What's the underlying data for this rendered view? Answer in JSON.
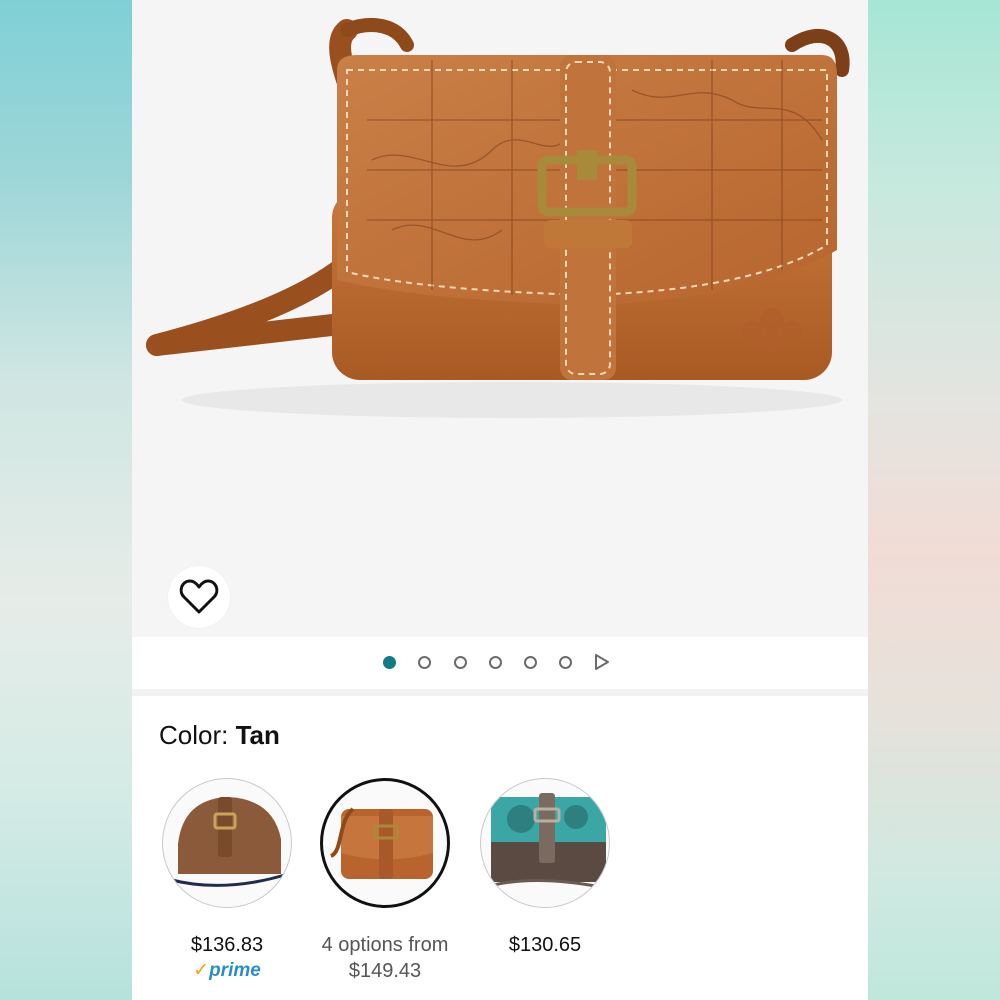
{
  "product": {
    "favorite_icon": "heart-outline-icon",
    "gallery": {
      "count": 6,
      "active_index": 0,
      "next_icon": "play-triangle-icon",
      "accent": "#0e7c86"
    }
  },
  "color_selector": {
    "label": "Color:",
    "selected": "Tan",
    "options": [
      {
        "name": "Brown swatch",
        "price": "$136.83",
        "prime_check": "✓",
        "prime_word": "prime"
      },
      {
        "name": "Tan swatch",
        "price_line1": "4 options from",
        "price_line2": "$149.43",
        "selected": true
      },
      {
        "name": "Turquoise swatch",
        "price": "$130.65"
      }
    ]
  },
  "colors": {
    "prime_blue": "#2a8dc9",
    "prime_orange": "#f0a21b",
    "leather": "#b8642c"
  }
}
